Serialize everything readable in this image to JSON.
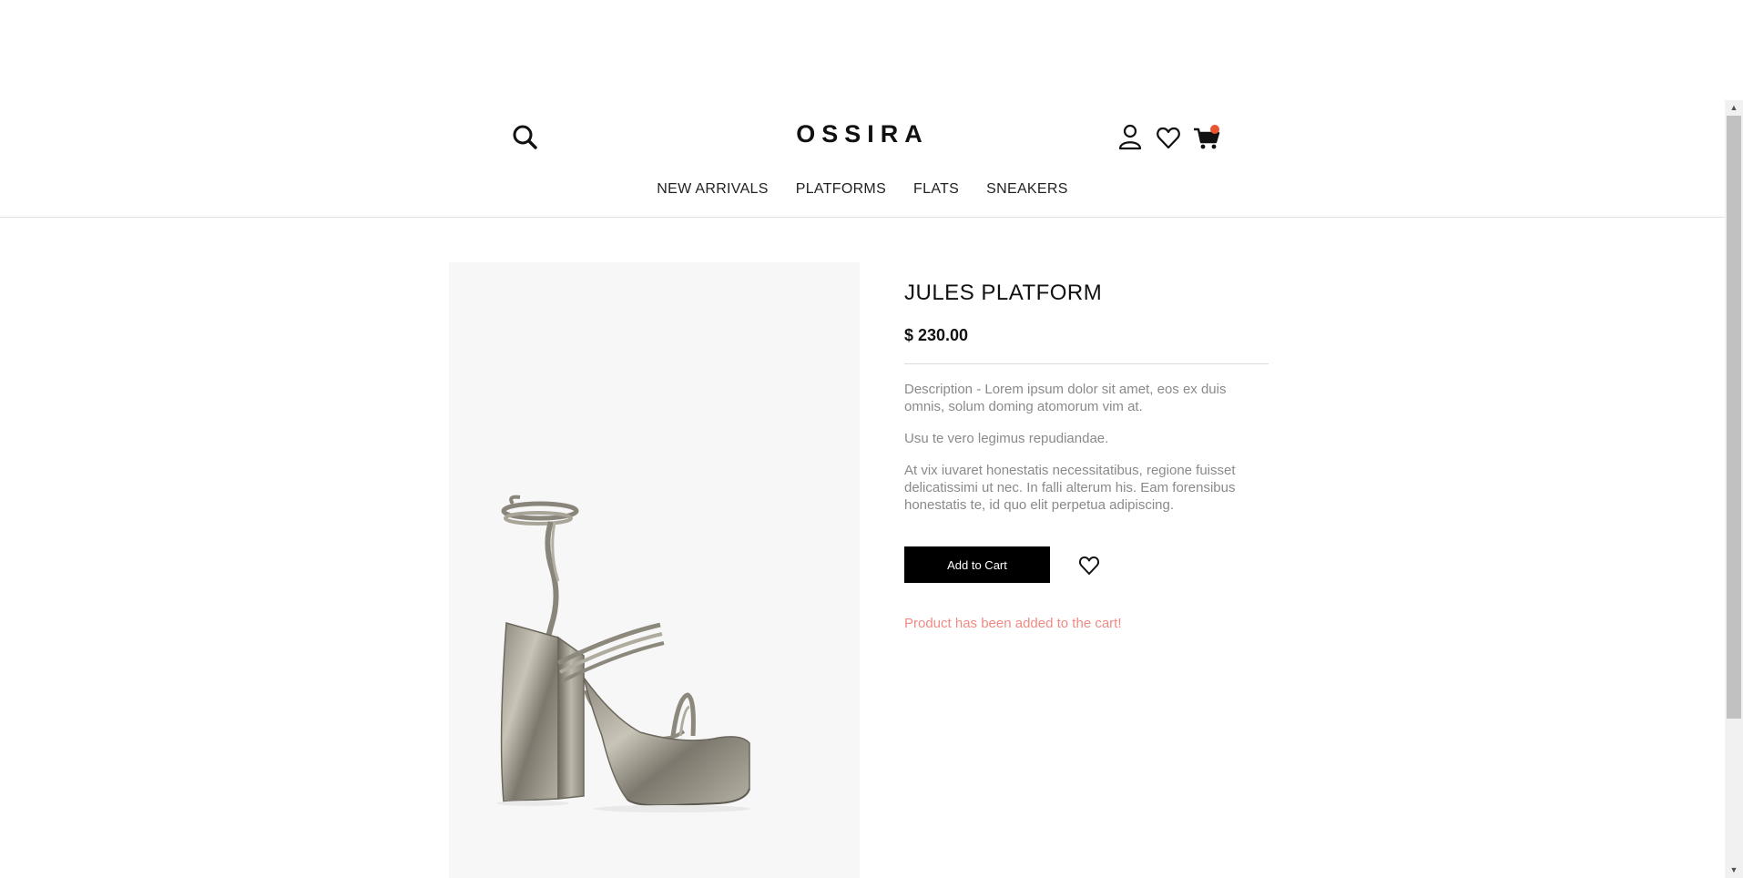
{
  "header": {
    "logo": "OSSIRA",
    "icons": [
      "search-icon",
      "user-icon",
      "heart-icon",
      "cart-icon"
    ],
    "cart_badge_color": "#e8552f"
  },
  "nav": {
    "items": [
      {
        "label": "NEW ARRIVALS"
      },
      {
        "label": "PLATFORMS"
      },
      {
        "label": "FLATS"
      },
      {
        "label": "SNEAKERS"
      }
    ]
  },
  "product": {
    "title": "JULES PLATFORM",
    "price": "$ 230.00",
    "description": [
      "Description - Lorem ipsum dolor sit amet, eos ex duis omnis, solum doming atomorum vim at.",
      "Usu te vero legimus repudiandae.",
      "At vix iuvaret honestatis necessitatibus, regione fuisset delicatissimi ut nec. In falli alterum his. Eam forensibus honestatis te, id quo elit perpetua adipiscing."
    ],
    "add_to_cart_label": "Add to Cart",
    "message": "Product has been added to the cart!",
    "message_color": "#f08a84",
    "image": "metallic-platform-sandal"
  }
}
